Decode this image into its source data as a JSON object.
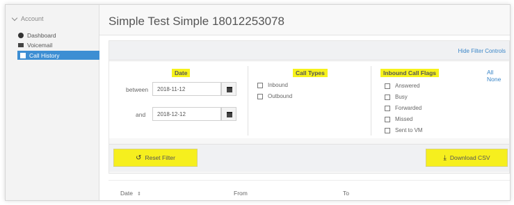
{
  "sidebar": {
    "section_label": "Account",
    "items": [
      {
        "label": "Dashboard"
      },
      {
        "label": "Voicemail"
      },
      {
        "label": "Call History"
      }
    ]
  },
  "page": {
    "title": "Simple Test Simple 18012253078",
    "hide_filter_controls": "Hide Filter Controls"
  },
  "filters": {
    "date": {
      "heading": "Date",
      "between_label": "between",
      "between_value": "2018-11-12",
      "and_label": "and",
      "and_value": "2018-12-12"
    },
    "call_types": {
      "heading": "Call Types",
      "options": [
        "Inbound",
        "Outbound"
      ]
    },
    "inbound_call_flags": {
      "heading": "Inbound Call Flags",
      "all_none": "All None",
      "options": [
        "Answered",
        "Busy",
        "Forwarded",
        "Missed",
        "Sent to VM"
      ]
    }
  },
  "buttons": {
    "reset_filter": "Reset Filter",
    "download_csv": "Download CSV"
  },
  "table": {
    "columns": [
      "Date",
      "From",
      "To"
    ]
  },
  "colors": {
    "highlight": "#f6f21b",
    "active_nav": "#3d8ed3",
    "link": "#3a86c8"
  }
}
